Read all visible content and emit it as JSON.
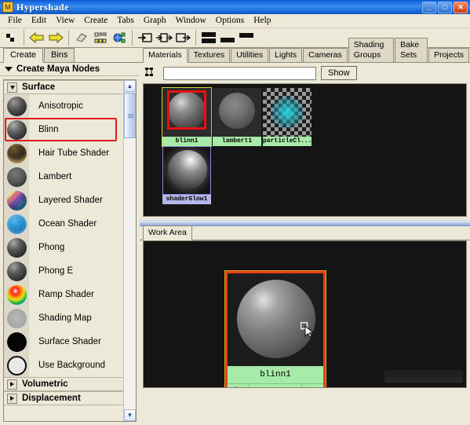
{
  "window": {
    "title": "Hypershade",
    "app_icon": "maya-window-icon",
    "buttons": [
      {
        "name": "minimize-button",
        "glyph": "_"
      },
      {
        "name": "maximize-button",
        "glyph": "□"
      },
      {
        "name": "close-button",
        "glyph": "✕"
      }
    ]
  },
  "menubar": {
    "items": [
      "File",
      "Edit",
      "View",
      "Create",
      "Tabs",
      "Graph",
      "Window",
      "Options",
      "Help"
    ]
  },
  "toolbar": {
    "groups": [
      {
        "buttons": [
          {
            "name": "rearrange-graph-icon"
          }
        ]
      },
      {
        "buttons": [
          {
            "name": "back-arrow-icon"
          },
          {
            "name": "forward-arrow-icon"
          }
        ]
      },
      {
        "buttons": [
          {
            "name": "clear-graph-icon"
          },
          {
            "name": "graph-network-icon"
          },
          {
            "name": "graph-materials-icon"
          }
        ]
      },
      {
        "buttons": [
          {
            "name": "input-connections-icon"
          },
          {
            "name": "input-output-connections-icon"
          },
          {
            "name": "output-connections-icon"
          }
        ]
      },
      {
        "buttons": [
          {
            "name": "layout-horizontal-split-icon"
          },
          {
            "name": "layout-bottom-only-icon"
          },
          {
            "name": "layout-top-only-icon"
          }
        ]
      }
    ]
  },
  "left_panel": {
    "tabs": [
      {
        "label": "Create",
        "active": true
      },
      {
        "label": "Bins",
        "active": false
      }
    ],
    "section": {
      "label": "Create Maya Nodes",
      "expanded": true
    },
    "groups": [
      {
        "label": "Surface",
        "expanded": true,
        "items": [
          {
            "label": "Anisotropic",
            "swatch": "dark-gray-sphere",
            "selected": false
          },
          {
            "label": "Blinn",
            "swatch": "dark-gray-sphere",
            "selected": true
          },
          {
            "label": "Hair Tube Shader",
            "swatch": "gold-tube-sphere",
            "selected": false
          },
          {
            "label": "Lambert",
            "swatch": "matte-gray-sphere",
            "selected": false
          },
          {
            "label": "Layered Shader",
            "swatch": "multicolor-sphere",
            "selected": false
          },
          {
            "label": "Ocean Shader",
            "swatch": "blue-ocean-sphere",
            "selected": false
          },
          {
            "label": "Phong",
            "swatch": "dark-gray-sphere",
            "selected": false
          },
          {
            "label": "Phong E",
            "swatch": "dark-gray-sphere",
            "selected": false
          },
          {
            "label": "Ramp Shader",
            "swatch": "rainbow-sphere",
            "selected": false
          },
          {
            "label": "Shading Map",
            "swatch": "flat-gray-sphere",
            "selected": false
          },
          {
            "label": "Surface Shader",
            "swatch": "black-sphere",
            "selected": false
          },
          {
            "label": "Use Background",
            "swatch": "outline-sphere",
            "selected": false
          }
        ]
      },
      {
        "label": "Volumetric",
        "expanded": false,
        "items": []
      },
      {
        "label": "Displacement",
        "expanded": false,
        "items": []
      }
    ]
  },
  "right_panel": {
    "tabs": [
      {
        "label": "Materials",
        "active": true
      },
      {
        "label": "Textures",
        "active": false
      },
      {
        "label": "Utilities",
        "active": false
      },
      {
        "label": "Lights",
        "active": false
      },
      {
        "label": "Cameras",
        "active": false
      },
      {
        "label": "Shading Groups",
        "active": false
      },
      {
        "label": "Bake Sets",
        "active": false
      },
      {
        "label": "Projects",
        "active": false
      }
    ],
    "search": {
      "value": "",
      "placeholder": "",
      "show_label": "Show",
      "filter_icon": "filter-nodes-icon"
    },
    "materials": [
      {
        "name": "blinn1",
        "swatch": "glossy-gray-sphere",
        "selected": true,
        "highlighted": true,
        "label_bg": "#a8eaa8"
      },
      {
        "name": "lambert1",
        "swatch": "matte-gray-sphere",
        "selected": false,
        "highlighted": false,
        "label_bg": "#a8eaa8"
      },
      {
        "name": "particleCl...",
        "swatch": "checker-teal-cloud",
        "selected": false,
        "highlighted": false,
        "label_bg": "#a8eaa8"
      },
      {
        "name": "shaderGlow1",
        "swatch": "glow-sphere",
        "selected": false,
        "highlighted": false,
        "label_bg": "#b6b6ea"
      }
    ]
  },
  "work_area": {
    "tabs": [
      {
        "label": "Work Area",
        "active": true
      }
    ],
    "nodes": [
      {
        "name": "blinn1",
        "swatch": "glossy-gray-sphere",
        "selected": true,
        "ports": {
          "input": "input-port-arrow",
          "expand": "expand-down-arrow",
          "output": "output-port-arrow"
        }
      }
    ],
    "cursor": "arrow-with-box-cursor"
  },
  "colors": {
    "title_blue": "#1c6fe0",
    "panel_bg": "#ece9d8",
    "canvas_bg": "#141414",
    "selection_red": "#e21c1c",
    "node_selected_border": "#e84010",
    "node_label_green": "#a8eaa8",
    "node_label_purple": "#b6b6ea"
  }
}
